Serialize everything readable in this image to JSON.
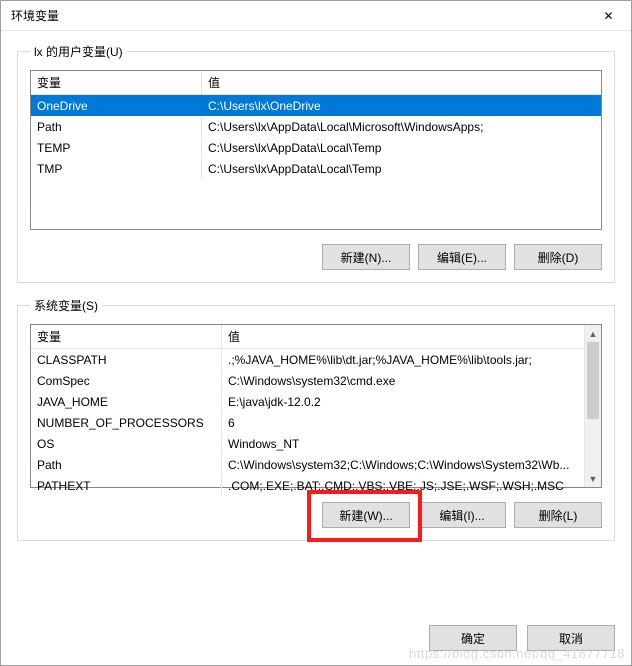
{
  "title": "环境变量",
  "user_section": {
    "legend": "lx 的用户变量(U)",
    "columns": {
      "name": "变量",
      "value": "值"
    },
    "rows": [
      {
        "name": "OneDrive",
        "value": "C:\\Users\\lx\\OneDrive",
        "selected": true
      },
      {
        "name": "Path",
        "value": "C:\\Users\\lx\\AppData\\Local\\Microsoft\\WindowsApps;",
        "selected": false
      },
      {
        "name": "TEMP",
        "value": "C:\\Users\\lx\\AppData\\Local\\Temp",
        "selected": false
      },
      {
        "name": "TMP",
        "value": "C:\\Users\\lx\\AppData\\Local\\Temp",
        "selected": false
      }
    ],
    "buttons": {
      "new": "新建(N)...",
      "edit": "编辑(E)...",
      "delete": "删除(D)"
    }
  },
  "system_section": {
    "legend": "系统变量(S)",
    "columns": {
      "name": "变量",
      "value": "值"
    },
    "rows": [
      {
        "name": "CLASSPATH",
        "value": ".;%JAVA_HOME%\\lib\\dt.jar;%JAVA_HOME%\\lib\\tools.jar;"
      },
      {
        "name": "ComSpec",
        "value": "C:\\Windows\\system32\\cmd.exe"
      },
      {
        "name": "JAVA_HOME",
        "value": "E:\\java\\jdk-12.0.2"
      },
      {
        "name": "NUMBER_OF_PROCESSORS",
        "value": "6"
      },
      {
        "name": "OS",
        "value": "Windows_NT"
      },
      {
        "name": "Path",
        "value": "C:\\Windows\\system32;C:\\Windows;C:\\Windows\\System32\\Wb..."
      },
      {
        "name": "PATHEXT",
        "value": ".COM;.EXE;.BAT;.CMD;.VBS;.VBE;.JS;.JSE;.WSF;.WSH;.MSC"
      }
    ],
    "buttons": {
      "new": "新建(W)...",
      "edit": "编辑(I)...",
      "delete": "删除(L)"
    }
  },
  "footer": {
    "ok": "确定",
    "cancel": "取消"
  },
  "watermark": "https://blog.csdn.net/qq_41877718"
}
